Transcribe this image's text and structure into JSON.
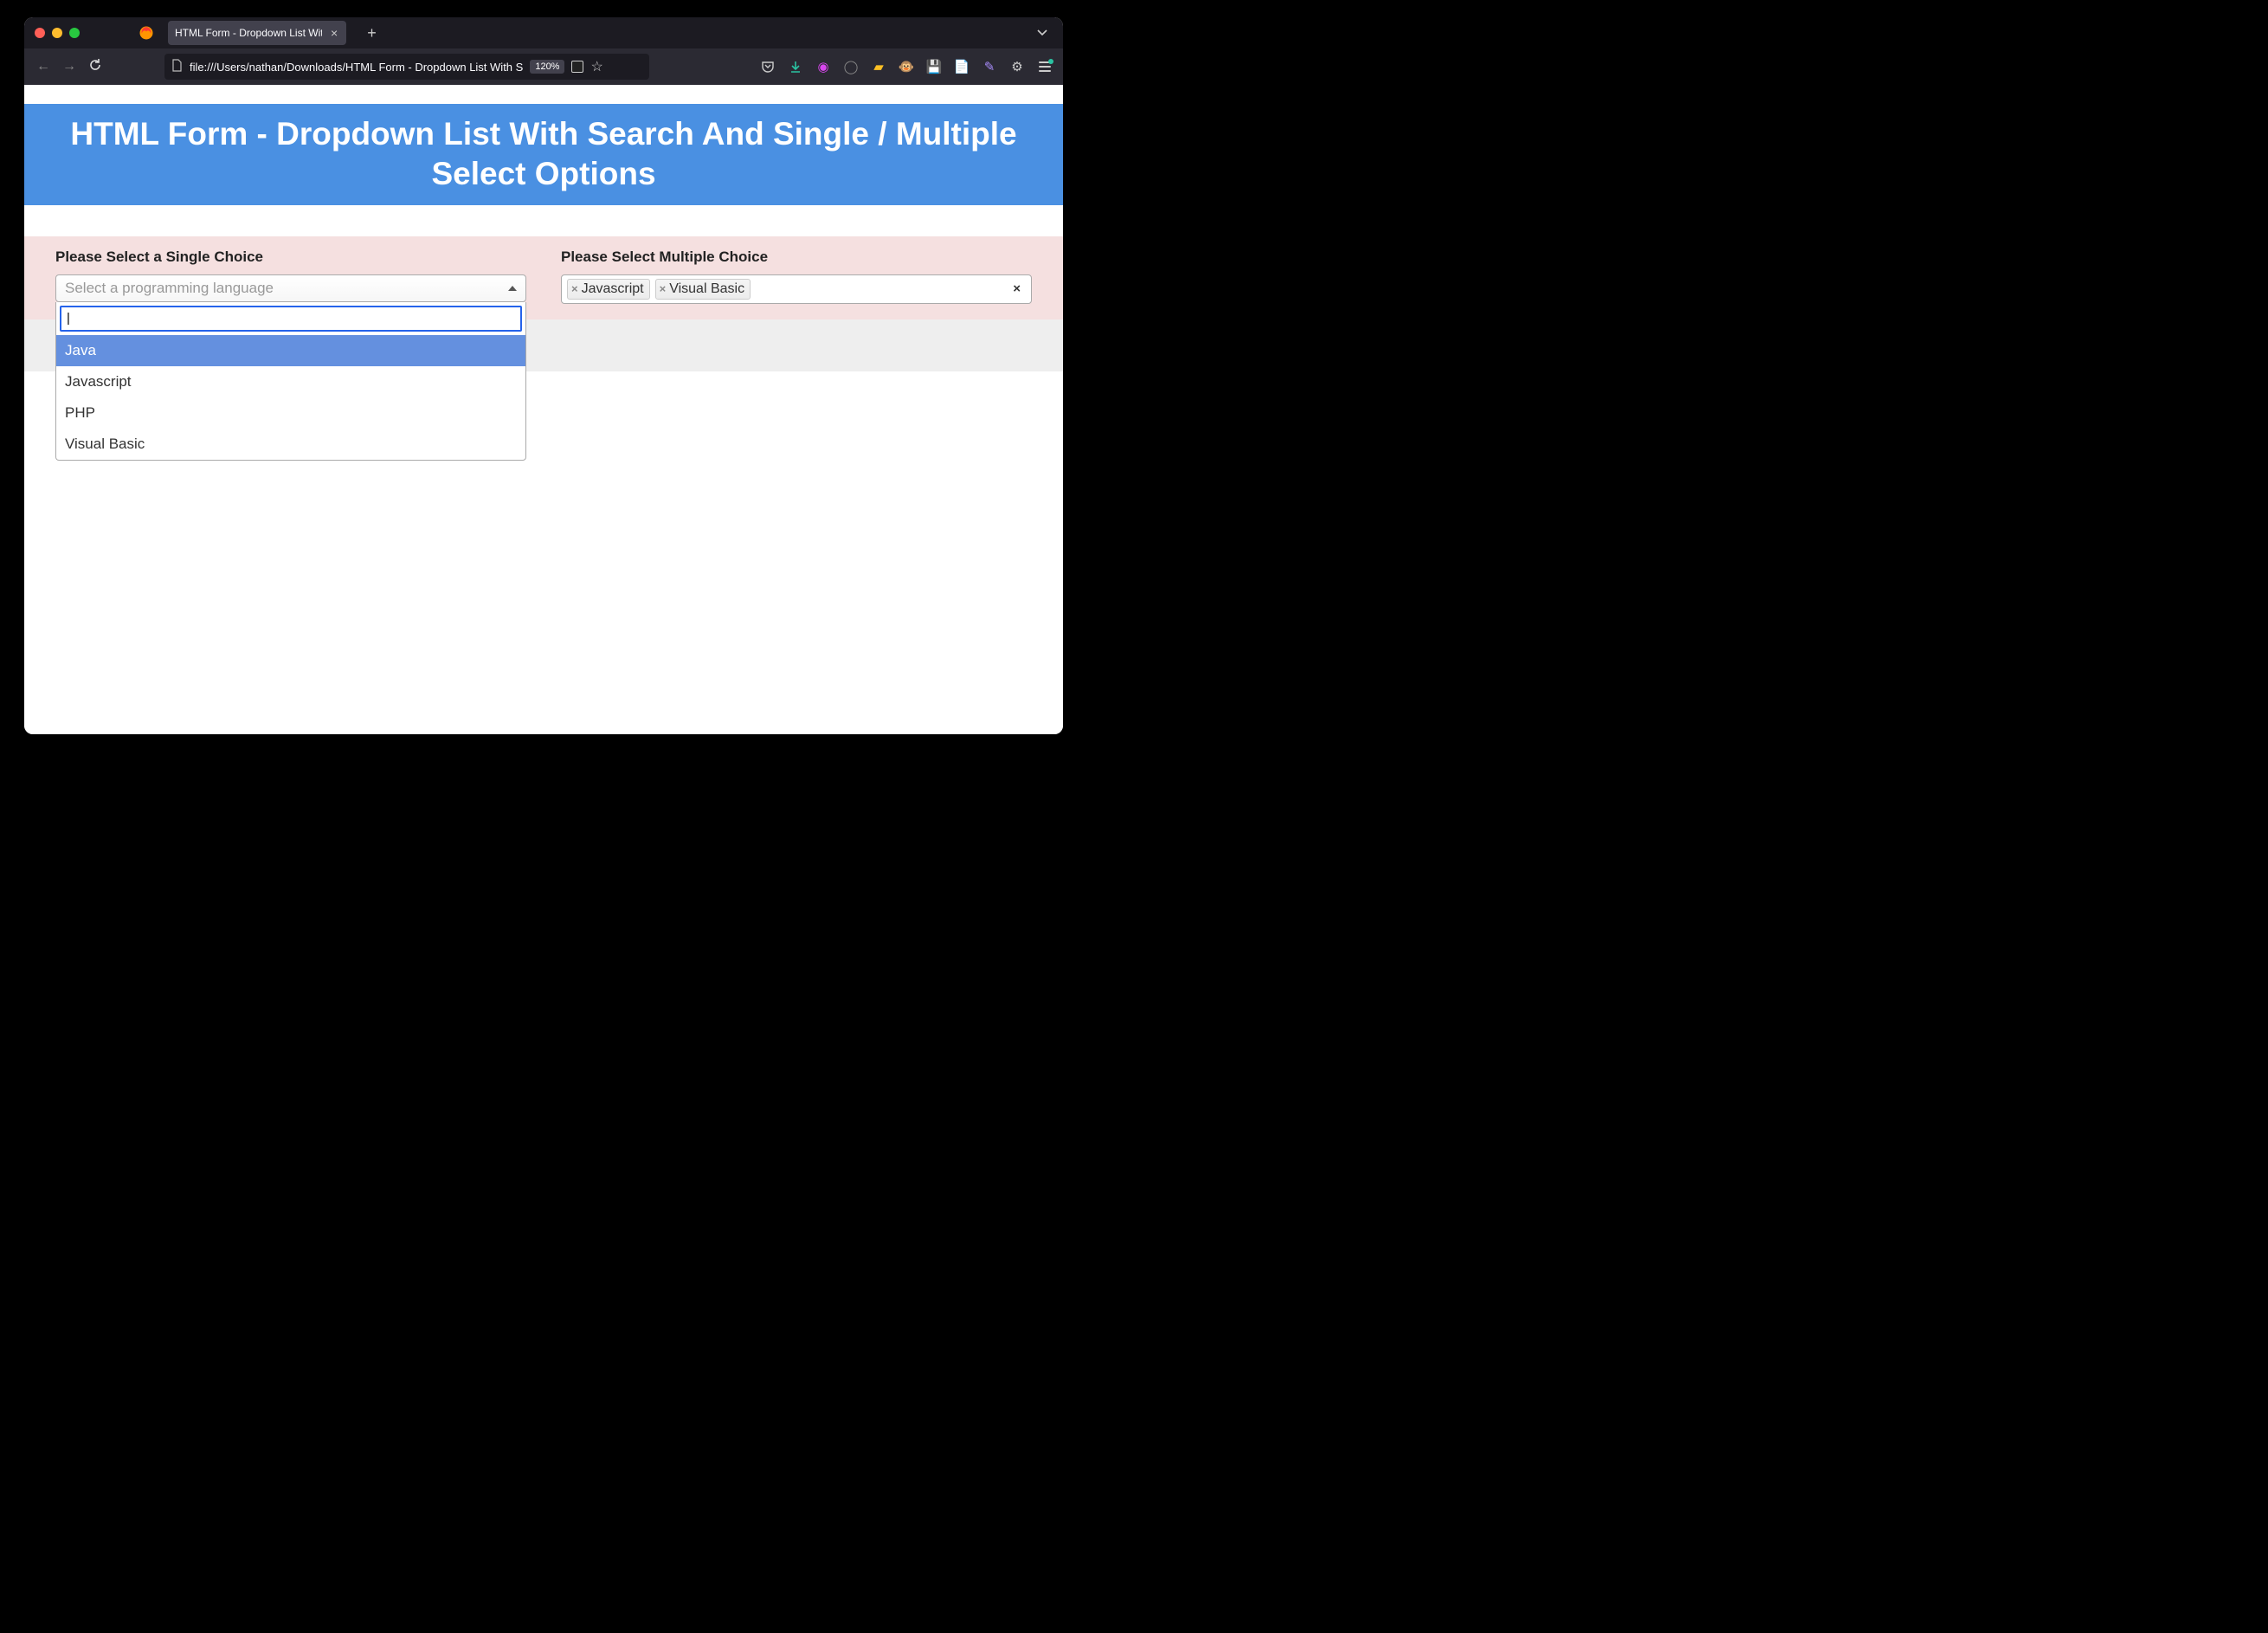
{
  "browser": {
    "tab_title": "HTML Form - Dropdown List With S",
    "url": "file:///Users/nathan/Downloads/HTML Form - Dropdown List With S",
    "zoom": "120%",
    "new_tab_symbol": "+",
    "close_symbol": "×",
    "nav": {
      "back": "←",
      "forward": "→",
      "reload": "↻"
    },
    "icons": {
      "pocket": "pocket-icon",
      "download": "download-icon",
      "ext1": "pin-icon",
      "ext2": "circle-icon",
      "ext3": "eraser-icon",
      "ext4": "monkey-icon",
      "ext5": "floppy-icon",
      "ext6": "note-icon",
      "ext7": "wand-icon",
      "ext8": "puzzle-icon",
      "menu": "hamburger-icon"
    }
  },
  "page": {
    "title": "HTML Form - Dropdown List With Search And Single / Multiple Select Options",
    "single": {
      "label": "Please Select a Single Choice",
      "placeholder": "Select a programming language",
      "search_value": "|",
      "options": [
        "Java",
        "Javascript",
        "PHP",
        "Visual Basic"
      ],
      "highlighted_index": 0
    },
    "multiple": {
      "label": "Please Select Multiple Choice",
      "selected": [
        "Javascript",
        "Visual Basic"
      ],
      "remove_symbol": "×",
      "clear_symbol": "×"
    }
  }
}
